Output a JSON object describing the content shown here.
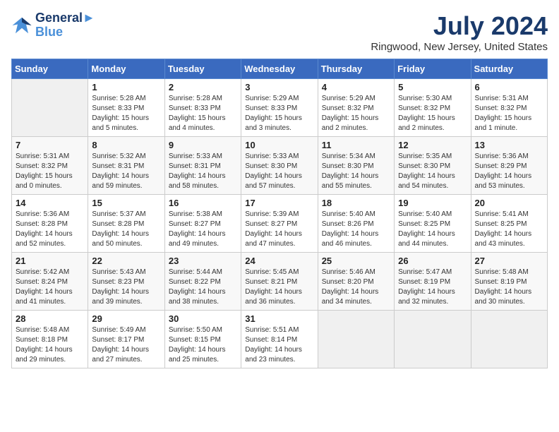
{
  "header": {
    "logo_line1": "General",
    "logo_line2": "Blue",
    "month_title": "July 2024",
    "location": "Ringwood, New Jersey, United States"
  },
  "days_of_week": [
    "Sunday",
    "Monday",
    "Tuesday",
    "Wednesday",
    "Thursday",
    "Friday",
    "Saturday"
  ],
  "weeks": [
    [
      {
        "day": "",
        "info": ""
      },
      {
        "day": "1",
        "info": "Sunrise: 5:28 AM\nSunset: 8:33 PM\nDaylight: 15 hours\nand 5 minutes."
      },
      {
        "day": "2",
        "info": "Sunrise: 5:28 AM\nSunset: 8:33 PM\nDaylight: 15 hours\nand 4 minutes."
      },
      {
        "day": "3",
        "info": "Sunrise: 5:29 AM\nSunset: 8:33 PM\nDaylight: 15 hours\nand 3 minutes."
      },
      {
        "day": "4",
        "info": "Sunrise: 5:29 AM\nSunset: 8:32 PM\nDaylight: 15 hours\nand 2 minutes."
      },
      {
        "day": "5",
        "info": "Sunrise: 5:30 AM\nSunset: 8:32 PM\nDaylight: 15 hours\nand 2 minutes."
      },
      {
        "day": "6",
        "info": "Sunrise: 5:31 AM\nSunset: 8:32 PM\nDaylight: 15 hours\nand 1 minute."
      }
    ],
    [
      {
        "day": "7",
        "info": "Sunrise: 5:31 AM\nSunset: 8:32 PM\nDaylight: 15 hours\nand 0 minutes."
      },
      {
        "day": "8",
        "info": "Sunrise: 5:32 AM\nSunset: 8:31 PM\nDaylight: 14 hours\nand 59 minutes."
      },
      {
        "day": "9",
        "info": "Sunrise: 5:33 AM\nSunset: 8:31 PM\nDaylight: 14 hours\nand 58 minutes."
      },
      {
        "day": "10",
        "info": "Sunrise: 5:33 AM\nSunset: 8:30 PM\nDaylight: 14 hours\nand 57 minutes."
      },
      {
        "day": "11",
        "info": "Sunrise: 5:34 AM\nSunset: 8:30 PM\nDaylight: 14 hours\nand 55 minutes."
      },
      {
        "day": "12",
        "info": "Sunrise: 5:35 AM\nSunset: 8:30 PM\nDaylight: 14 hours\nand 54 minutes."
      },
      {
        "day": "13",
        "info": "Sunrise: 5:36 AM\nSunset: 8:29 PM\nDaylight: 14 hours\nand 53 minutes."
      }
    ],
    [
      {
        "day": "14",
        "info": "Sunrise: 5:36 AM\nSunset: 8:28 PM\nDaylight: 14 hours\nand 52 minutes."
      },
      {
        "day": "15",
        "info": "Sunrise: 5:37 AM\nSunset: 8:28 PM\nDaylight: 14 hours\nand 50 minutes."
      },
      {
        "day": "16",
        "info": "Sunrise: 5:38 AM\nSunset: 8:27 PM\nDaylight: 14 hours\nand 49 minutes."
      },
      {
        "day": "17",
        "info": "Sunrise: 5:39 AM\nSunset: 8:27 PM\nDaylight: 14 hours\nand 47 minutes."
      },
      {
        "day": "18",
        "info": "Sunrise: 5:40 AM\nSunset: 8:26 PM\nDaylight: 14 hours\nand 46 minutes."
      },
      {
        "day": "19",
        "info": "Sunrise: 5:40 AM\nSunset: 8:25 PM\nDaylight: 14 hours\nand 44 minutes."
      },
      {
        "day": "20",
        "info": "Sunrise: 5:41 AM\nSunset: 8:25 PM\nDaylight: 14 hours\nand 43 minutes."
      }
    ],
    [
      {
        "day": "21",
        "info": "Sunrise: 5:42 AM\nSunset: 8:24 PM\nDaylight: 14 hours\nand 41 minutes."
      },
      {
        "day": "22",
        "info": "Sunrise: 5:43 AM\nSunset: 8:23 PM\nDaylight: 14 hours\nand 39 minutes."
      },
      {
        "day": "23",
        "info": "Sunrise: 5:44 AM\nSunset: 8:22 PM\nDaylight: 14 hours\nand 38 minutes."
      },
      {
        "day": "24",
        "info": "Sunrise: 5:45 AM\nSunset: 8:21 PM\nDaylight: 14 hours\nand 36 minutes."
      },
      {
        "day": "25",
        "info": "Sunrise: 5:46 AM\nSunset: 8:20 PM\nDaylight: 14 hours\nand 34 minutes."
      },
      {
        "day": "26",
        "info": "Sunrise: 5:47 AM\nSunset: 8:19 PM\nDaylight: 14 hours\nand 32 minutes."
      },
      {
        "day": "27",
        "info": "Sunrise: 5:48 AM\nSunset: 8:19 PM\nDaylight: 14 hours\nand 30 minutes."
      }
    ],
    [
      {
        "day": "28",
        "info": "Sunrise: 5:48 AM\nSunset: 8:18 PM\nDaylight: 14 hours\nand 29 minutes."
      },
      {
        "day": "29",
        "info": "Sunrise: 5:49 AM\nSunset: 8:17 PM\nDaylight: 14 hours\nand 27 minutes."
      },
      {
        "day": "30",
        "info": "Sunrise: 5:50 AM\nSunset: 8:15 PM\nDaylight: 14 hours\nand 25 minutes."
      },
      {
        "day": "31",
        "info": "Sunrise: 5:51 AM\nSunset: 8:14 PM\nDaylight: 14 hours\nand 23 minutes."
      },
      {
        "day": "",
        "info": ""
      },
      {
        "day": "",
        "info": ""
      },
      {
        "day": "",
        "info": ""
      }
    ]
  ]
}
